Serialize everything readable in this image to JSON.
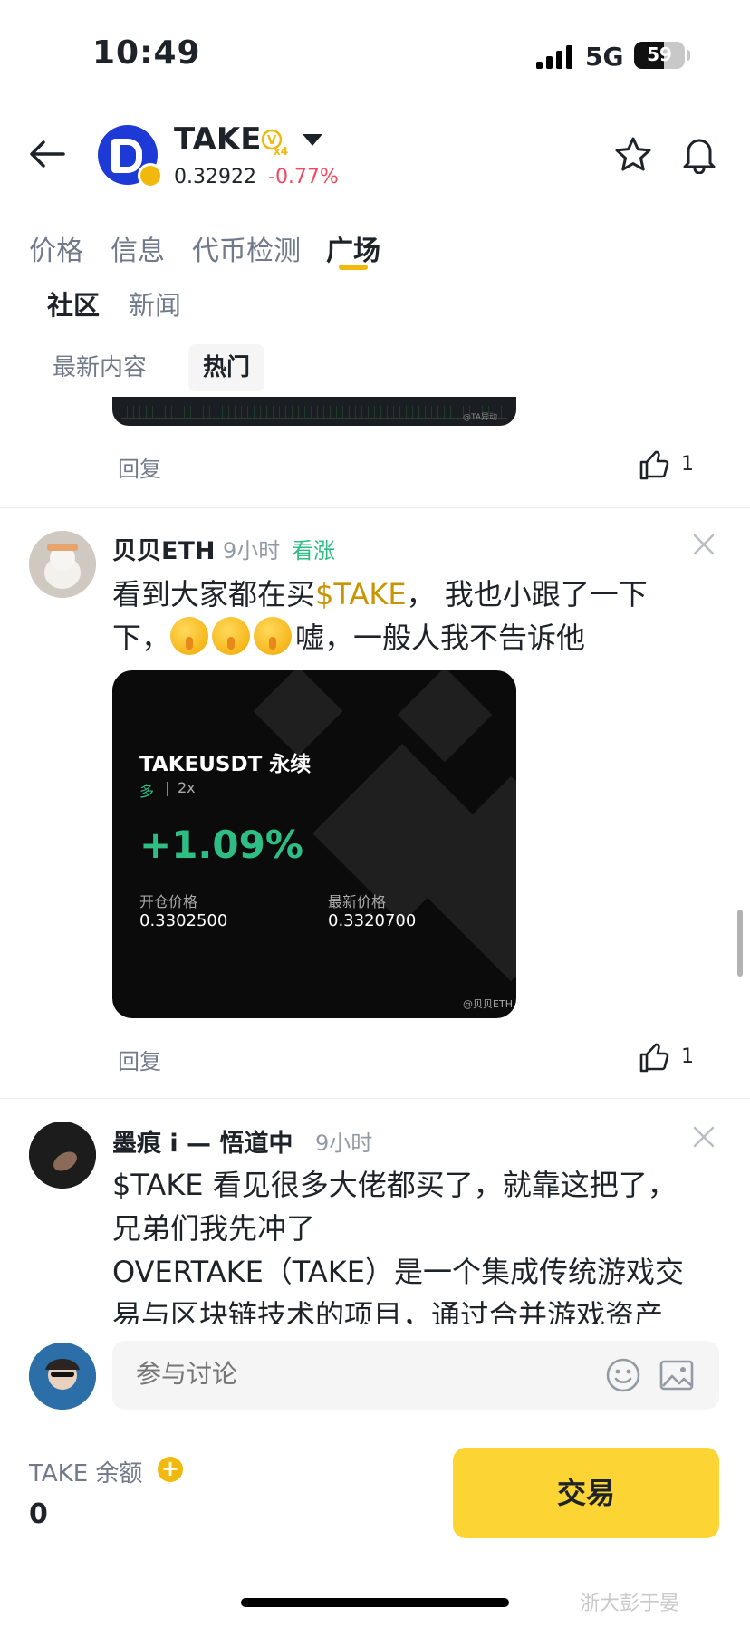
{
  "status_bar": {
    "time": "10:49",
    "network": "5G",
    "battery": "59",
    "battery_level": 0.59
  },
  "header": {
    "symbol": "TAKE",
    "price": "0.32922",
    "change": "-0.77%",
    "tag": "V x4"
  },
  "tabs": [
    {
      "label": "价格"
    },
    {
      "label": "信息"
    },
    {
      "label": "代币检测"
    },
    {
      "label": "广场"
    }
  ],
  "subtabs": [
    {
      "label": "社区"
    },
    {
      "label": "新闻"
    }
  ],
  "filters": [
    {
      "label": "最新内容"
    },
    {
      "label": "热门"
    }
  ],
  "prev_post": {
    "reply": "回复",
    "likes": "1",
    "image_watermark": "@TA异动…"
  },
  "posts": [
    {
      "author": "贝贝ETH",
      "time": "9小时",
      "sentiment": "看涨",
      "text_before": "看到大家都在买",
      "cashtag": "$TAKE",
      "text_after": "， 我也小跟了一下下，",
      "text_end": "嘘，一般人我不告诉他",
      "card": {
        "title": "TAKEUSDT 永续",
        "side": "多",
        "leverage": "2x",
        "pnl": "+1.09%",
        "open_label": "开仓价格",
        "open_value": "0.3302500",
        "last_label": "最新价格",
        "last_value": "0.3320700",
        "watermark": "@贝贝ETH"
      },
      "reply": "回复",
      "likes": "1"
    },
    {
      "author": "墨痕 i — 悟道中",
      "time": "9小时",
      "line1": "$TAKE 看见很多大佬都买了，就靠这把了，",
      "line2": "兄弟们我先冲了",
      "line3": "OVERTAKE（TAKE）是一个集成传统游戏交",
      "line4": "易与区块链技术的项目，通过合并游戏资产"
    }
  ],
  "composer": {
    "placeholder": "参与讨论"
  },
  "footer": {
    "balance_label": "TAKE 余额",
    "balance_value": "0",
    "trade_label": "交易",
    "watermark": "浙大彭于晏"
  },
  "colors": {
    "accent": "#f0b90b",
    "up": "#2ebd85",
    "down": "#f6465d",
    "trade_button": "#fcd535"
  }
}
